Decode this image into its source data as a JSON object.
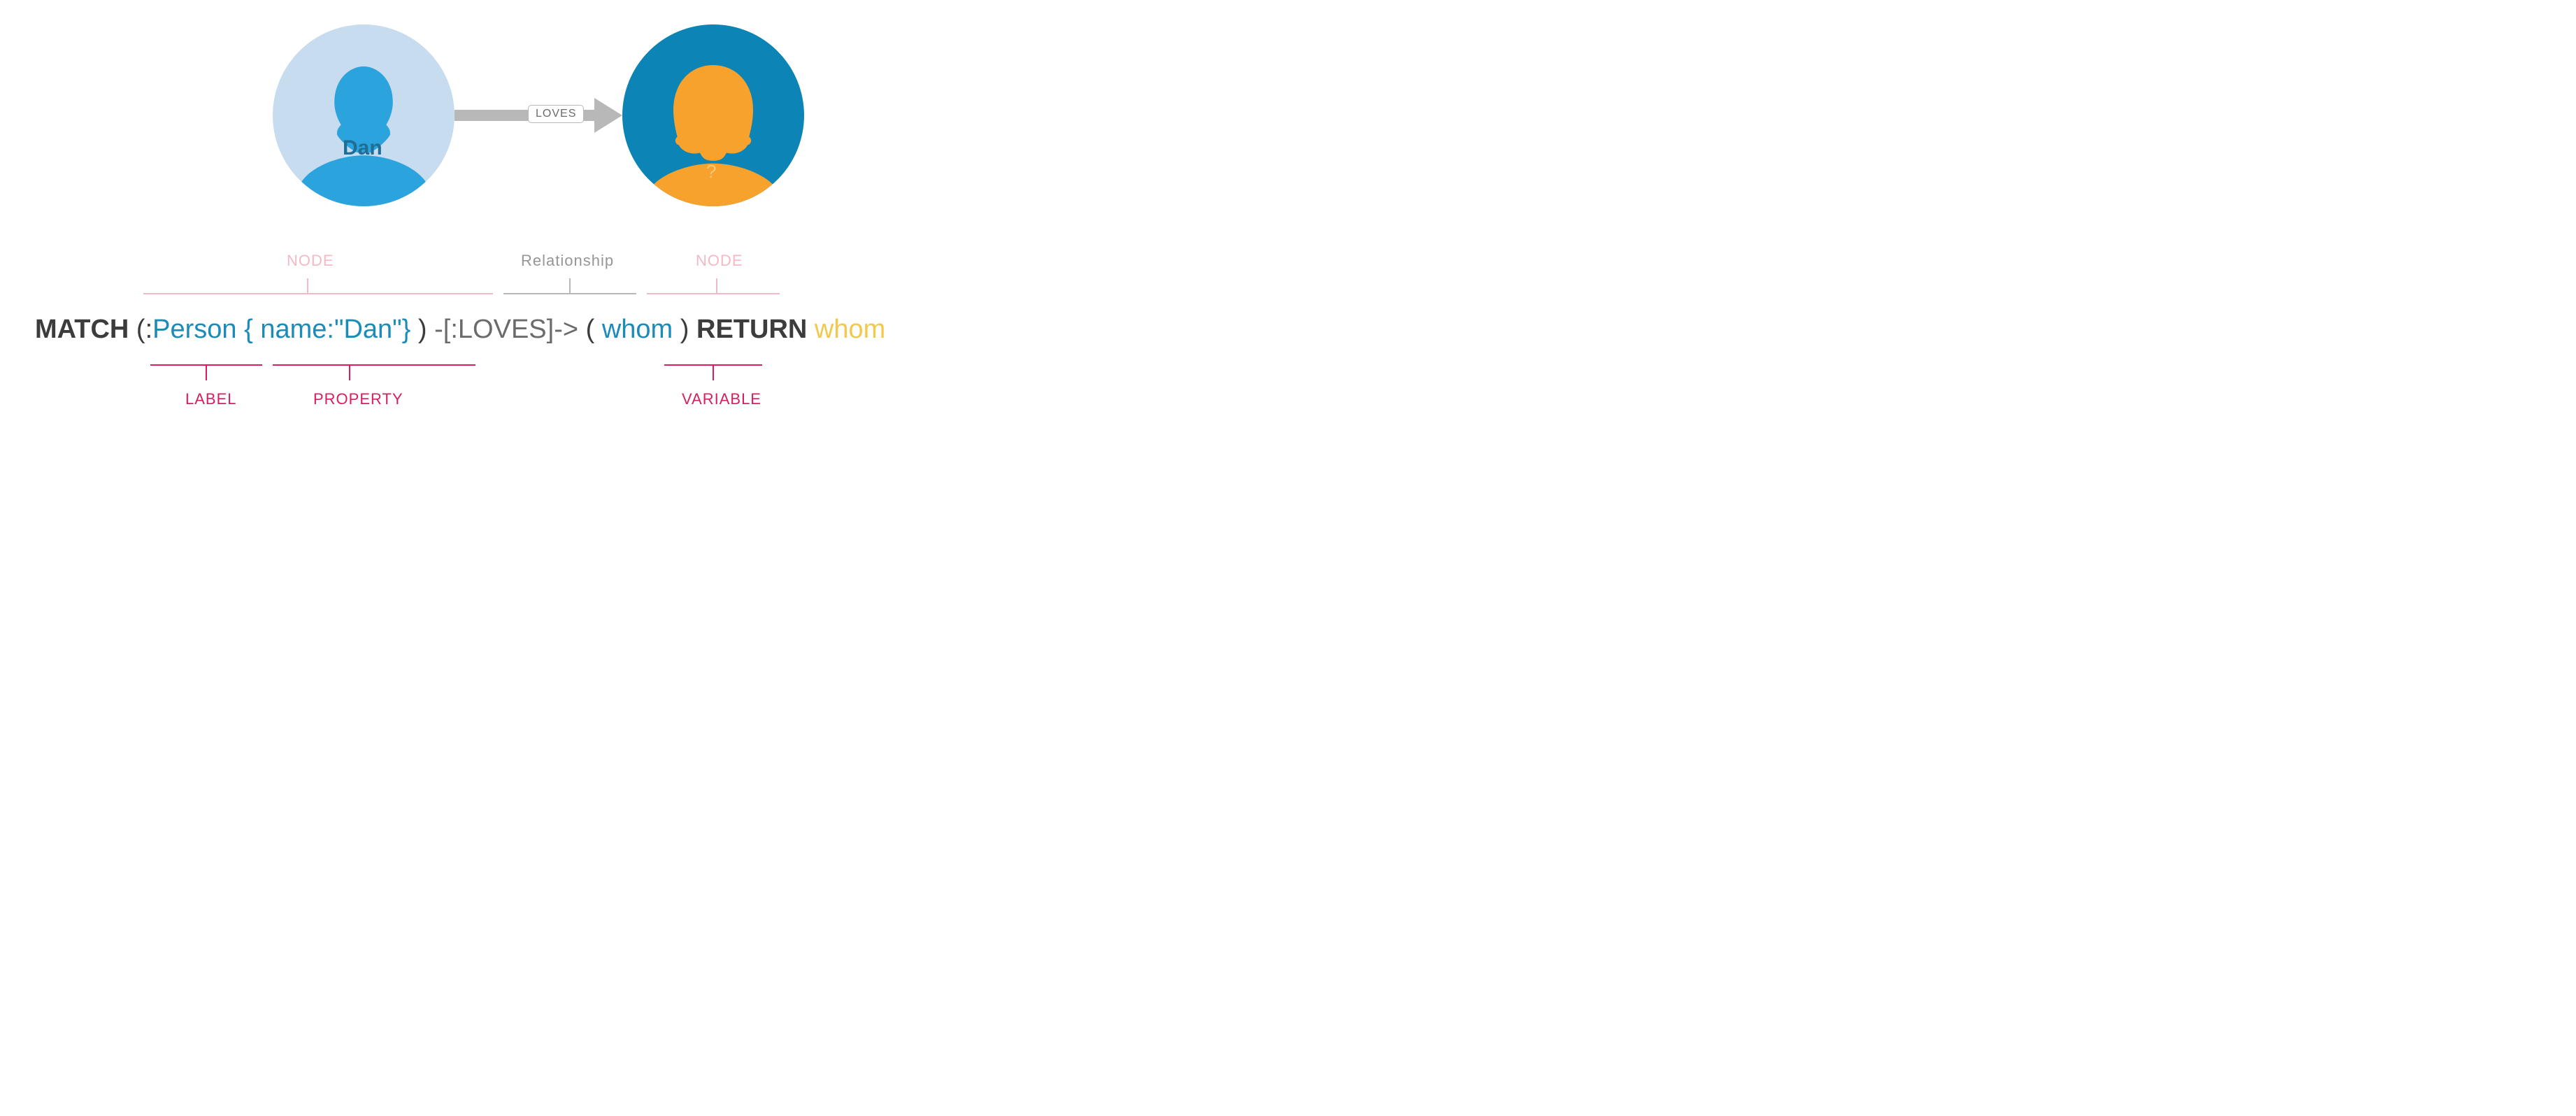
{
  "avatars": {
    "dan": {
      "label": "Dan"
    },
    "whom": {
      "label": "?"
    }
  },
  "arrow": {
    "label": "LOVES"
  },
  "top_annotations": {
    "node1": "NODE",
    "relationship": "Relationship",
    "node2": "NODE"
  },
  "query": {
    "match": "MATCH",
    "paren1": " (",
    "colon": ":",
    "person": "Person ",
    "props": "{ name:\"Dan\"}",
    "paren2": " ) ",
    "rel": "-[:LOVES]->",
    "paren3": " ( ",
    "whom": "whom",
    "paren4": " ) ",
    "return": "RETURN",
    "whom_ret": " whom"
  },
  "bottom_annotations": {
    "label": "LABEL",
    "property": "PROPERTY",
    "variable": "VARIABLE"
  }
}
